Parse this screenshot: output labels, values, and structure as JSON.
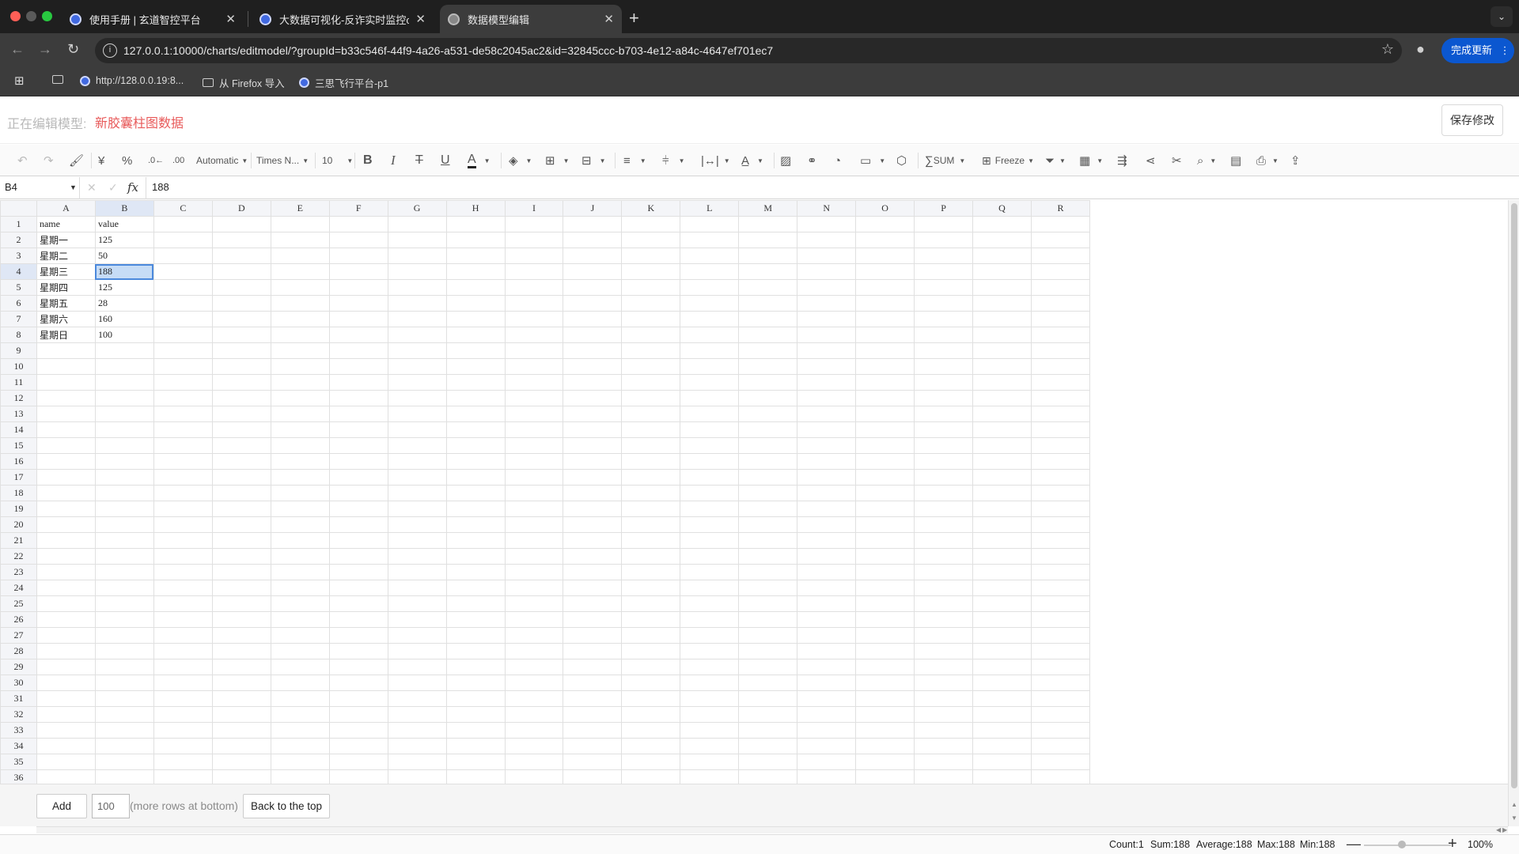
{
  "browser": {
    "tabs": [
      {
        "title": "使用手册 | 玄道智控平台",
        "close": "✕"
      },
      {
        "title": "大数据可视化-反诈实时监控c",
        "close": "✕"
      },
      {
        "title": "数据模型编辑",
        "close": "✕"
      }
    ],
    "new_tab": "+",
    "url": "127.0.0.1:10000/charts/editmodel/?groupId=b33c546f-44f9-4a26-a531-de58c2045ac2&id=32845ccc-b703-4e12-a84c-4647ef701ec7",
    "update_button": "完成更新",
    "bookmarks": [
      "http://128.0.0.19:8...",
      "从 Firefox 导入",
      "三思飞行平台-p1"
    ]
  },
  "header": {
    "edit_label": "正在编辑模型:",
    "model_name": "新胶囊柱图数据",
    "save_button": "保存修改"
  },
  "toolbar": {
    "number_format": "Automatic",
    "font_family": "Times N...",
    "font_size": "10",
    "currency": "¥",
    "percent": "%",
    "sum": "SUM",
    "freeze": "Freeze"
  },
  "formula_bar": {
    "cell_ref": "B4",
    "fx": "fx",
    "value": "188"
  },
  "sheet": {
    "columns": [
      "A",
      "B",
      "C",
      "D",
      "E",
      "F",
      "G",
      "H",
      "I",
      "J",
      "K",
      "L",
      "M",
      "N",
      "O",
      "P",
      "Q",
      "R"
    ],
    "row_numbers": [
      "1",
      "2",
      "3",
      "4",
      "5",
      "6",
      "7",
      "8",
      "9",
      "10",
      "11",
      "12",
      "13",
      "14",
      "15",
      "16",
      "17",
      "18",
      "19",
      "20",
      "21",
      "22",
      "23",
      "24",
      "25",
      "26",
      "27",
      "28",
      "29",
      "30",
      "31",
      "32",
      "33",
      "34",
      "35",
      "36"
    ],
    "rows": [
      [
        "name",
        "value"
      ],
      [
        "星期一",
        "125"
      ],
      [
        "星期二",
        "50"
      ],
      [
        "星期三",
        "188"
      ],
      [
        "星期四",
        "125"
      ],
      [
        "星期五",
        "28"
      ],
      [
        "星期六",
        "160"
      ],
      [
        "星期日",
        "100"
      ]
    ],
    "selected": {
      "row": 4,
      "col": "B"
    }
  },
  "footer": {
    "add_button": "Add",
    "add_count": "100",
    "more_rows": "(more rows at bottom)",
    "back_to_top": "Back to the top"
  },
  "status": {
    "count": "Count:1",
    "sum": "Sum:188",
    "average": "Average:188",
    "max": "Max:188",
    "min": "Min:188",
    "zoom": "100%"
  },
  "colors": {
    "accent": "#0b57d0",
    "model_name": "#e85a5a",
    "selection": "#4b89dc"
  }
}
